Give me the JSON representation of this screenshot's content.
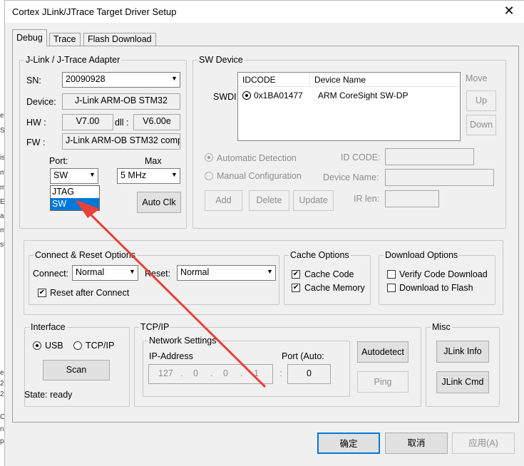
{
  "window": {
    "title": "Cortex JLink/JTrace Target Driver Setup",
    "close_glyph": "✕"
  },
  "tabs": [
    "Debug",
    "Trace",
    "Flash Download"
  ],
  "adapter": {
    "group_label": "J-Link / J-Trace Adapter",
    "sn_label": "SN:",
    "sn_value": "20090928",
    "device_label": "Device:",
    "device_value": "J-Link ARM-OB STM32",
    "hw_label": "HW :",
    "hw_value": "V7.00",
    "dll_label": "dll :",
    "dll_value": "V6.00e",
    "fw_label": "FW :",
    "fw_value": "J-Link ARM-OB STM32 comp",
    "port_label": "Port:",
    "port_value": "SW",
    "port_options": [
      "JTAG",
      "SW"
    ],
    "port_selected": "SW",
    "max_label": "Max",
    "max_value": "5 MHz",
    "auto_clk_button": "Auto Clk"
  },
  "sw_device": {
    "group_label": "SW Device",
    "row_label": "SWDI",
    "columns": [
      "IDCODE",
      "Device Name"
    ],
    "rows": [
      {
        "idcode": "0x1BA01477",
        "device_name": "ARM CoreSight SW-DP"
      }
    ],
    "move_label": "Move",
    "up_button": "Up",
    "down_button": "Down",
    "automatic_detection": "Automatic Detection",
    "manual_configuration": "Manual Configuration",
    "id_code_label": "ID CODE:",
    "device_name_label": "Device Name:",
    "ir_len_label": "IR len:",
    "add_button": "Add",
    "delete_button": "Delete",
    "update_button": "Update"
  },
  "connect_reset": {
    "group_label": "Connect & Reset Options",
    "connect_label": "Connect:",
    "connect_value": "Normal",
    "reset_label": "Reset:",
    "reset_value": "Normal",
    "reset_after_connect": "Reset after Connect",
    "reset_after_connect_checked": true
  },
  "cache": {
    "group_label": "Cache Options",
    "cache_code": "Cache Code",
    "cache_memory": "Cache Memory"
  },
  "download": {
    "group_label": "Download Options",
    "verify": "Verify Code Download",
    "download_flash": "Download to Flash"
  },
  "interface": {
    "group_label": "Interface",
    "usb": "USB",
    "tcpip": "TCP/IP",
    "scan_button": "Scan",
    "state": "State: ready"
  },
  "tcpip": {
    "group_label": "TCP/IP",
    "network_settings": "Network Settings",
    "ip_label": "IP-Address",
    "port_label": "Port (Auto:",
    "ip_octets": [
      "127",
      "0",
      "0",
      "1"
    ],
    "port_value": "0",
    "autodetect_button": "Autodetect",
    "ping_button": "Ping"
  },
  "misc": {
    "group_label": "Misc",
    "jlink_info_button": "JLink Info",
    "jlink_cmd_button": "JLink Cmd"
  },
  "footer": {
    "ok_button": "确定",
    "cancel_button": "取消",
    "apply_button": "应用(A)"
  },
  "background_fragments": [
    "e",
    "S",
    "is",
    "m",
    "m",
    "E",
    "ar",
    "m",
    "st",
    "e",
    "2",
    "2",
    "C",
    "n",
    "p"
  ],
  "colors": {
    "accent": "#0078d7",
    "arrow": "#e8403a"
  }
}
